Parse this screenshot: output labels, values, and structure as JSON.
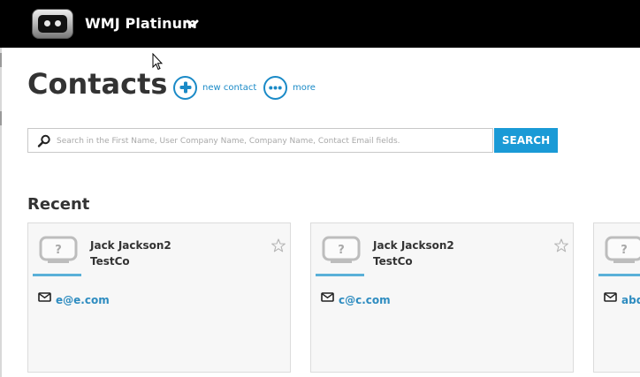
{
  "header": {
    "app_name": "WMJ Platinum",
    "logo_icon": "robot-logo-icon",
    "dropdown_icon": "chevron-down-icon"
  },
  "page": {
    "title": "Contacts",
    "actions": [
      {
        "label": "new contact",
        "icon": "plus-circle-icon"
      },
      {
        "label": "more",
        "icon": "ellipsis-circle-icon"
      }
    ]
  },
  "search": {
    "placeholder": "Search in the First Name, User Company Name, Company Name, Contact Email fields.",
    "value": "",
    "button_label": "SEARCH"
  },
  "recent": {
    "heading": "Recent",
    "cards": [
      {
        "name": "Jack Jackson2",
        "company": "TestCo",
        "email": "e@e.com"
      },
      {
        "name": "Jack Jackson2",
        "company": "TestCo",
        "email": "c@c.com"
      },
      {
        "name": "",
        "company": "",
        "email": "abd"
      }
    ]
  },
  "colors": {
    "accent": "#1a9ad6",
    "link": "#2e8cc0",
    "topbar": "#000000",
    "card_bg": "#f7f7f7"
  }
}
